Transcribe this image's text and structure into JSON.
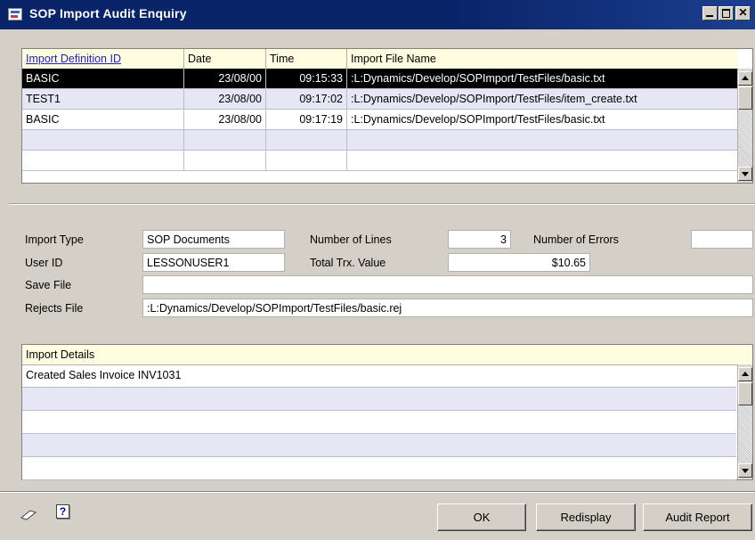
{
  "window": {
    "title": "SOP Import Audit Enquiry"
  },
  "audit_grid": {
    "columns": [
      "Import Definition ID",
      "Date",
      "Time",
      "Import File Name"
    ],
    "rows": [
      {
        "id": "BASIC",
        "date": "23/08/00",
        "time": "09:15:33",
        "file": ":L:Dynamics/Develop/SOPImport/TestFiles/basic.txt",
        "selected": true
      },
      {
        "id": "TEST1",
        "date": "23/08/00",
        "time": "09:17:02",
        "file": ":L:Dynamics/Develop/SOPImport/TestFiles/item_create.txt",
        "selected": false
      },
      {
        "id": "BASIC",
        "date": "23/08/00",
        "time": "09:17:19",
        "file": ":L:Dynamics/Develop/SOPImport/TestFiles/basic.txt",
        "selected": false
      },
      {
        "id": "",
        "date": "",
        "time": "",
        "file": "",
        "selected": false
      },
      {
        "id": "",
        "date": "",
        "time": "",
        "file": "",
        "selected": false
      }
    ]
  },
  "details": {
    "import_type_label": "Import Type",
    "import_type_value": "SOP Documents",
    "user_id_label": "User ID",
    "user_id_value": "LESSONUSER1",
    "save_file_label": "Save File",
    "save_file_value": "",
    "rejects_file_label": "Rejects File",
    "rejects_file_value": ":L:Dynamics/Develop/SOPImport/TestFiles/basic.rej",
    "number_of_lines_label": "Number of Lines",
    "number_of_lines_value": "3",
    "total_trx_value_label": "Total Trx. Value",
    "total_trx_value_value": "$10.65",
    "number_of_errors_label": "Number of Errors",
    "number_of_errors_value": ""
  },
  "import_details": {
    "header": "Import Details",
    "rows": [
      "Created Sales Invoice INV1031",
      "",
      "",
      "",
      ""
    ]
  },
  "buttons": {
    "ok": "OK",
    "redisplay": "Redisplay",
    "audit_report": "Audit Report"
  },
  "icons": {
    "note": "note-icon",
    "help": "help-icon"
  },
  "help_glyph": "?"
}
